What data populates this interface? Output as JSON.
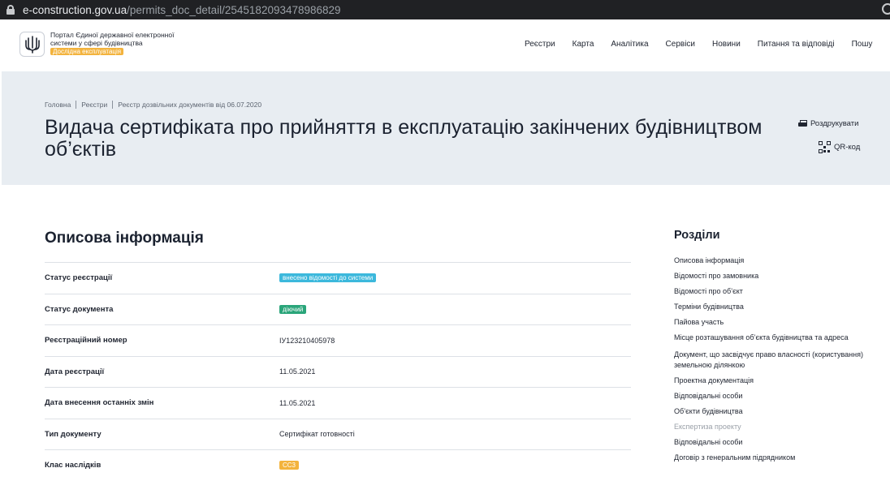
{
  "browser": {
    "url_host": "e-construction.gov.ua",
    "url_path": "/permits_doc_detail/2545182093478986829"
  },
  "header": {
    "portal_name": "Портал Єдиної державної електронної системи у сфері будівництва",
    "beta_badge": "Дослідна експлуатація",
    "nav": [
      "Реєстри",
      "Карта",
      "Аналітика",
      "Сервіси",
      "Новини",
      "Питання та відповіді",
      "Пошу"
    ]
  },
  "breadcrumb": [
    "Головна",
    "Реєстри",
    "Реєстр дозвільних документів від 06.07.2020"
  ],
  "page_title": "Видача сертифіката про прийняття в експлуатацію закінчених будівництвом об’єктів",
  "actions": {
    "print": "Роздрукувати",
    "qr": "QR-код"
  },
  "main": {
    "section_title": "Описова інформація",
    "rows": [
      {
        "label": "Статус реєстрації",
        "value": "внесено відомості до системи",
        "type": "chip",
        "color": "#3cb8dc"
      },
      {
        "label": "Статус документа",
        "value": "діючий",
        "type": "chip",
        "color": "#2aa57a"
      },
      {
        "label": "Реєстраційний номер",
        "value": "ІУ123210405978",
        "type": "text"
      },
      {
        "label": "Дата реєстрації",
        "value": "11.05.2021",
        "type": "text"
      },
      {
        "label": "Дата внесення останніх змін",
        "value": "11.05.2021",
        "type": "text"
      },
      {
        "label": "Тип документу",
        "value": "Сертифікат готовності",
        "type": "text"
      },
      {
        "label": "Клас наслідків",
        "value": "СС3",
        "type": "chip",
        "color": "#f3b33d"
      }
    ]
  },
  "sidebar": {
    "title": "Розділи",
    "items": [
      "Описова інформація",
      "Відомості про замовника",
      "Відомості про об’єкт",
      "Терміни будівництва",
      "Пайова участь",
      "Місце розташування об’єкта будівництва та адреса",
      "Документ, що засвідчує право власності (користування) земельною ділянкою",
      "Проектна документація",
      "Відповідальні особи",
      "Об’єкти будівництва",
      "Експертиза проекту",
      "Відповідальні особи",
      "Договір з генеральним підрядником"
    ],
    "muted_color": "#9aa0a8"
  }
}
